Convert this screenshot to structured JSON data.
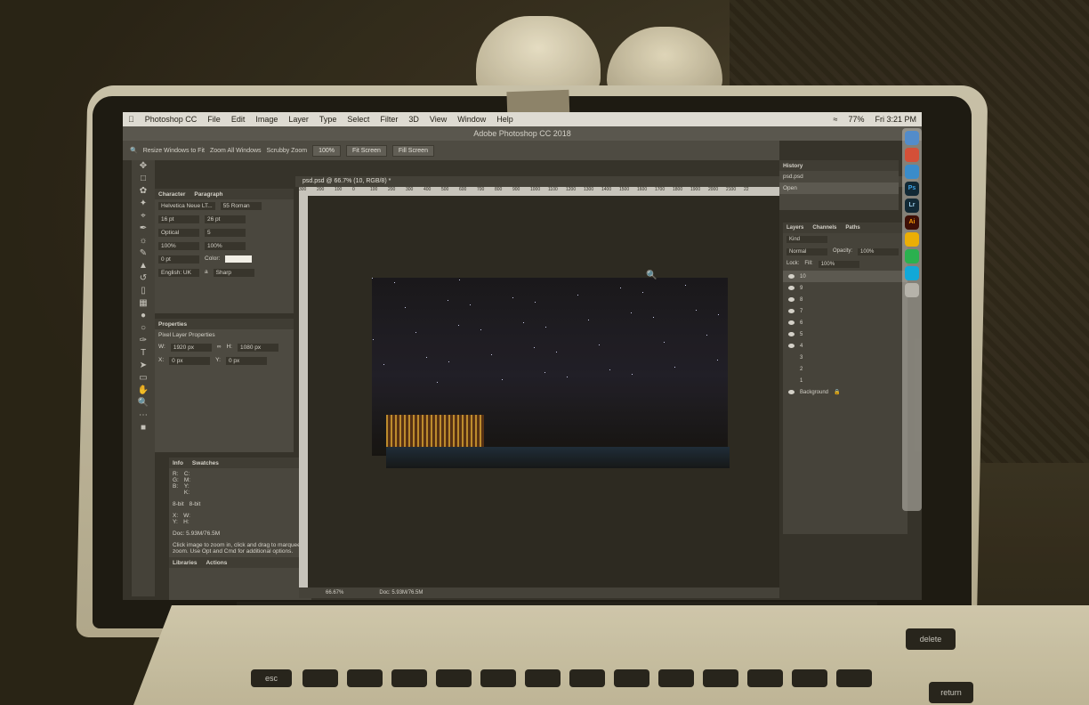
{
  "menubar": {
    "apple": "",
    "items": [
      "Photoshop CC",
      "File",
      "Edit",
      "Image",
      "Layer",
      "Type",
      "Select",
      "Filter",
      "3D",
      "View",
      "Window",
      "Help"
    ],
    "battery": "77%",
    "clock": "Fri 3:21 PM"
  },
  "window": {
    "title": "Adobe Photoshop CC 2018"
  },
  "options_bar": {
    "resize_windows": "Resize Windows to Fit",
    "zoom_all": "Zoom All Windows",
    "scrubby_zoom": "Scrubby Zoom",
    "zoom_value": "100%",
    "fit_screen": "Fit Screen",
    "fill_screen": "Fill Screen"
  },
  "document_tab": {
    "label": "psd.psd @ 66.7% (10, RGB/8) *"
  },
  "ruler_ticks": [
    "300",
    "200",
    "100",
    "0",
    "100",
    "200",
    "300",
    "400",
    "500",
    "600",
    "700",
    "800",
    "900",
    "1000",
    "1100",
    "1200",
    "1300",
    "1400",
    "1500",
    "1600",
    "1700",
    "1800",
    "1900",
    "2000",
    "2100",
    "22"
  ],
  "character_panel": {
    "tabs": [
      "Character",
      "Paragraph"
    ],
    "font_family": "Helvetica Neue LT...",
    "font_style": "55 Roman",
    "size": "16 pt",
    "leading": "26 pt",
    "kerning": "Optical",
    "tracking": "5",
    "vscale": "100%",
    "hscale": "100%",
    "baseline": "0 pt",
    "color_label": "Color:",
    "language": "English: UK",
    "aa_prefix": "a",
    "aa": "Sharp"
  },
  "properties_panel": {
    "tab": "Properties",
    "title": "Pixel Layer Properties",
    "w": "1920 px",
    "h": "1080 px",
    "x": "0 px",
    "y": "0 px",
    "w_label": "W:",
    "h_label": "H:",
    "x_label": "X:",
    "y_label": "Y:"
  },
  "info_panel": {
    "tabs": [
      "Info",
      "Swatches"
    ],
    "rgb_labels": "R:\nG:\nB:",
    "cmyk_labels": "C:\nM:\nY:\nK:",
    "bit_left": "8-bit",
    "bit_right": "8-bit",
    "xy": "X:\nY:",
    "wh": "W:\nH:",
    "doc": "Doc: 5.93M/76.5M",
    "help": "Click image to zoom in, click and drag to marquee zoom.  Use Opt and Cmd for additional options."
  },
  "bottom_tabs": [
    "Libraries",
    "Actions"
  ],
  "status_bar": {
    "zoom": "66.67%",
    "doc": "Doc: 5.93M/76.5M"
  },
  "history_panel": {
    "tab": "History",
    "snapshot": "psd.psd",
    "step": "Open"
  },
  "layers_panel": {
    "tabs": [
      "Layers",
      "Channels",
      "Paths"
    ],
    "kind": "Kind",
    "blend": "Normal",
    "opacity_label": "Opacity:",
    "opacity": "100%",
    "lock_label": "Lock:",
    "fill_label": "Fill:",
    "fill": "100%",
    "layers": [
      "10",
      "9",
      "8",
      "7",
      "6",
      "5",
      "4",
      "3",
      "2",
      "1",
      "Background"
    ]
  },
  "dock_apps": [
    "Ps",
    "Lr",
    "Ai"
  ],
  "keyboard_keys": [
    "esc",
    "delete",
    "return"
  ],
  "colors": {
    "ui_dark": "#2a2a2a",
    "panel": "#404040",
    "city_lights": "#e3a531",
    "sky": "#0a0b18"
  }
}
